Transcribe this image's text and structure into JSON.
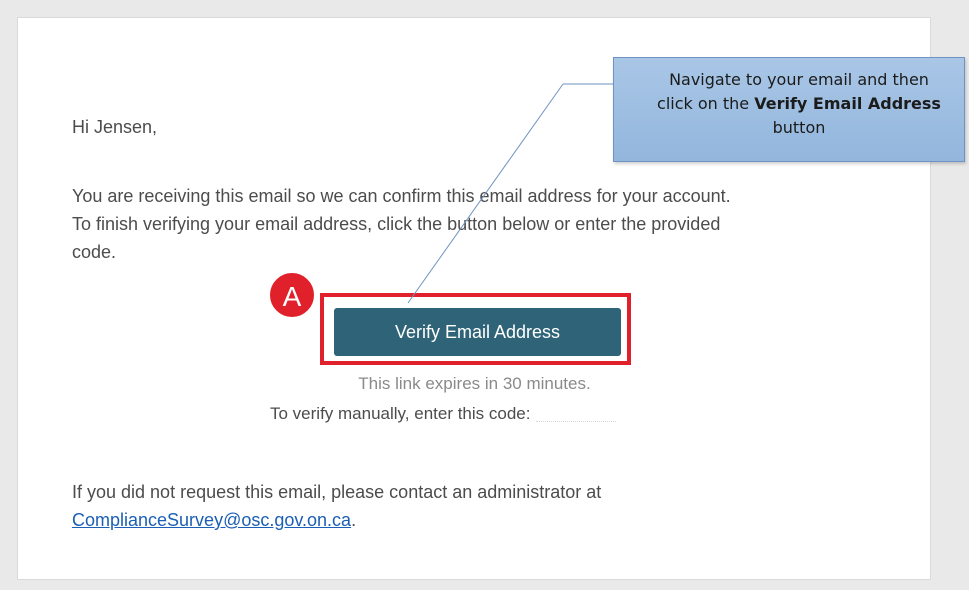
{
  "email": {
    "greeting": "Hi Jensen,",
    "body_line1": "You are receiving this email so we can confirm this email address for your account.",
    "body_line2": "To finish verifying your email address, click the button below or enter the provided",
    "body_line3": "code.",
    "verify_button_label": "Verify Email Address",
    "expires_text": "This link expires in 30 minutes.",
    "manual_code_label": "To verify manually, enter this code:",
    "footer_text": "If you did not request this email, please contact an administrator at",
    "contact_email": "ComplianceSurvey@osc.gov.on.ca",
    "footer_end": "."
  },
  "annotation": {
    "marker_label": "A",
    "callout_line1": "Navigate to your email and then",
    "callout_line2_prefix": "click on the ",
    "callout_line2_bold": "Verify Email Address",
    "callout_line3": "button",
    "highlight_color": "#e0202a",
    "callout_color": "#a9c6e6"
  },
  "colors": {
    "button": "#2f6478",
    "link": "#1a5fb4",
    "body_text": "#4c4c4c"
  }
}
